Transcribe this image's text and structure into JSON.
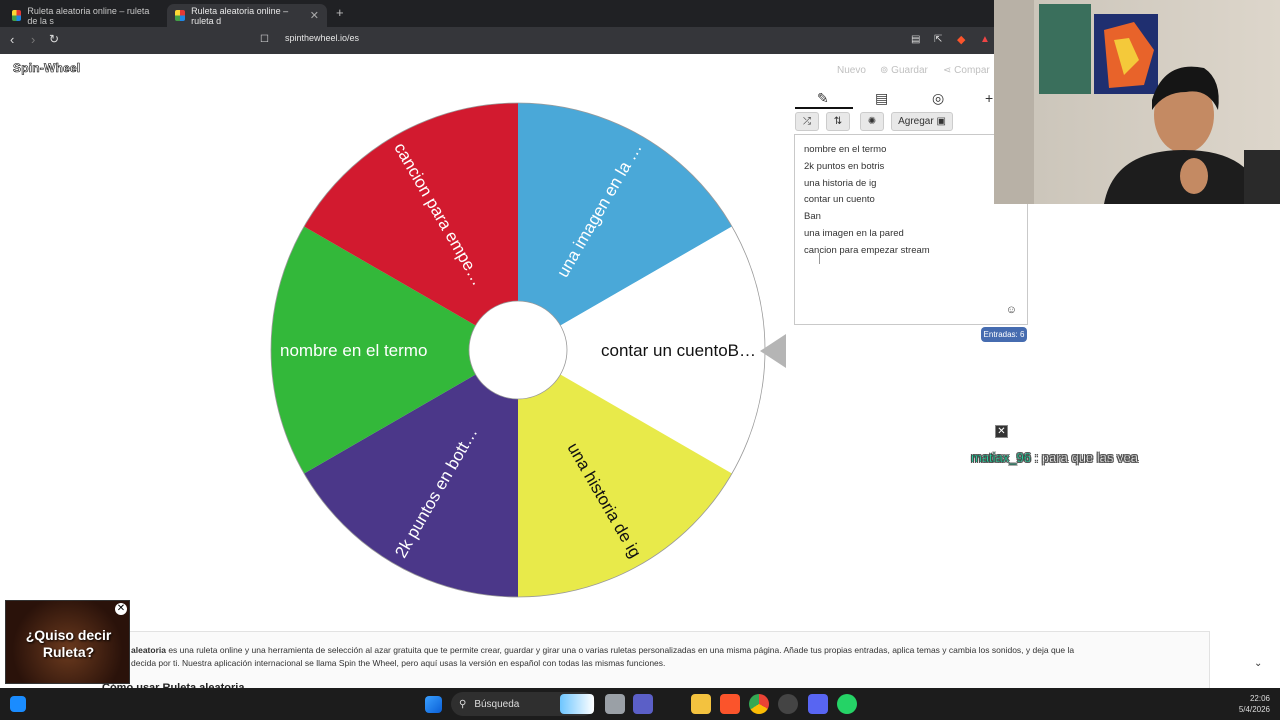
{
  "browser": {
    "tabs": [
      {
        "title": "Ruleta aleatoria online – ruleta de la s"
      },
      {
        "title": "Ruleta aleatoria online – ruleta d"
      }
    ],
    "url": "spinthewheel.io/es"
  },
  "app": {
    "logo": "Spin-Wheel",
    "menu": {
      "nuevo": "Nuevo",
      "guardar": "Guardar",
      "compartir": "Compar"
    }
  },
  "wheel": {
    "segments": [
      {
        "label": "una imagen en la …",
        "color": "#4aa8d8"
      },
      {
        "label": "contar un cuentoB…",
        "color": "#ffffff"
      },
      {
        "label": "una historia de ig",
        "color": "#e8ea4a"
      },
      {
        "label": "2k puntos en bott…",
        "color": "#4b3789"
      },
      {
        "label": "nombre en el termo",
        "color": "#33b83a"
      },
      {
        "label": "cancion para empe…",
        "color": "#d21a2f"
      }
    ]
  },
  "editor": {
    "add_button": "Agregar",
    "entries": [
      "nombre en el termo",
      "2k puntos en botris",
      "una historia de ig",
      "contar un cuento",
      "Ban",
      "una imagen en la pared",
      "cancion para empezar stream"
    ],
    "count_label": "Entradas: 6"
  },
  "chat": {
    "user": "matiax_96",
    "message": ": para que las vea"
  },
  "description": {
    "bold": "aleatoria",
    "text": " es una ruleta online y una herramienta de selección al azar gratuita que te permite crear, guardar y girar una o varias ruletas personalizadas en una misma página. Añade tus propias entradas, aplica temas y cambia los sonidos, y deja que la",
    "text2": "decida por ti. Nuestra aplicación internacional se llama Spin the Wheel, pero aquí usas la versión en español con todas las mismas funciones.",
    "heading": "Cómo usar Ruleta aleatoria"
  },
  "overlay": {
    "line1": "¿Quiso decir",
    "line2": "Ruleta?"
  },
  "taskbar": {
    "search": "Búsqueda",
    "time": "22:06",
    "date": "5/4/2026"
  }
}
